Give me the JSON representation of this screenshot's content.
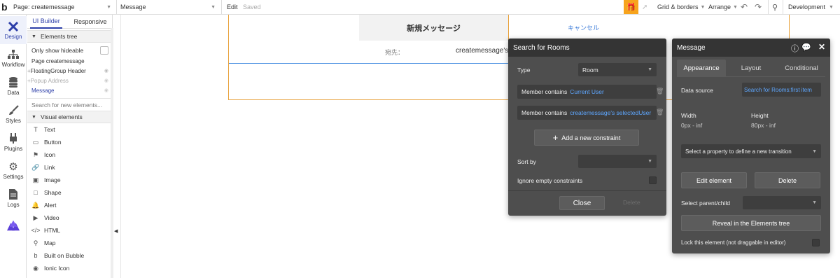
{
  "topbar": {
    "logo": "b",
    "page_label": "Page: createmessage",
    "element_select": "Message",
    "edit_label": "Edit",
    "saved_label": "Saved",
    "grid_borders_label": "Grid & borders",
    "arrange_label": "Arrange",
    "environment_label": "Development",
    "accent_color": "#f7a41d"
  },
  "rail": {
    "items": [
      {
        "label": "Design",
        "icon": "design-icon"
      },
      {
        "label": "Workflow",
        "icon": "workflow-icon"
      },
      {
        "label": "Data",
        "icon": "data-icon"
      },
      {
        "label": "Styles",
        "icon": "styles-icon"
      },
      {
        "label": "Plugins",
        "icon": "plugins-icon"
      },
      {
        "label": "Settings",
        "icon": "settings-icon"
      },
      {
        "label": "Logs",
        "icon": "logs-icon"
      }
    ]
  },
  "panel": {
    "tab_ui_builder": "UI Builder",
    "tab_responsive": "Responsive",
    "elements_tree_label": "Elements tree",
    "only_show_hideable": "Only show hideable",
    "tree": [
      {
        "label": "Page createmessage"
      },
      {
        "label": "FloatingGroup Header"
      },
      {
        "label": "Popup Address"
      },
      {
        "label": "Message"
      }
    ],
    "search_placeholder": "Search for new elements...",
    "visual_elements_label": "Visual elements",
    "visual_elements": [
      {
        "label": "Text",
        "icon": "text-icon",
        "glyph": "T"
      },
      {
        "label": "Button",
        "icon": "button-icon",
        "glyph": "▭"
      },
      {
        "label": "Icon",
        "icon": "flag-icon",
        "glyph": "⚑"
      },
      {
        "label": "Link",
        "icon": "link-icon",
        "glyph": "🔗"
      },
      {
        "label": "Image",
        "icon": "image-icon",
        "glyph": "▣"
      },
      {
        "label": "Shape",
        "icon": "shape-icon",
        "glyph": "□"
      },
      {
        "label": "Alert",
        "icon": "bell-icon",
        "glyph": "🔔"
      },
      {
        "label": "Video",
        "icon": "video-icon",
        "glyph": "▶"
      },
      {
        "label": "HTML",
        "icon": "code-icon",
        "glyph": "</>"
      },
      {
        "label": "Map",
        "icon": "map-pin-icon",
        "glyph": "⚲"
      },
      {
        "label": "Built on Bubble",
        "icon": "bubble-icon",
        "glyph": "b"
      },
      {
        "label": "Ionic Icon",
        "icon": "ionic-icon",
        "glyph": "◉"
      }
    ]
  },
  "canvas": {
    "header_title": "新規メッセージ",
    "cancel_label": "キャンセル",
    "to_label": "宛先：",
    "to_value": "createmessage's"
  },
  "search_popup": {
    "title": "Search for Rooms",
    "type_label": "Type",
    "type_value": "Room",
    "constraint1_label": "Member contains",
    "constraint1_value": "Current User",
    "constraint2_label": "Member contains",
    "constraint2_value": "createmessage's selectedUser",
    "add_constraint_label": "Add a new constraint",
    "sort_by_label": "Sort by",
    "ignore_empty_label": "Ignore empty constraints",
    "close_label": "Close",
    "delete_label": "Delete"
  },
  "message_popup": {
    "title": "Message",
    "tabs": [
      "Appearance",
      "Layout",
      "Conditional"
    ],
    "data_source_label": "Data source",
    "data_source_value": "Search for Rooms:first item",
    "width_label": "Width",
    "width_value": "0px - inf",
    "height_label": "Height",
    "height_value": "80px - inf",
    "transition_label": "Select a property to define a new transition",
    "edit_element_label": "Edit element",
    "delete_label": "Delete",
    "select_parent_label": "Select parent/child",
    "reveal_label": "Reveal in the Elements tree",
    "lock_label": "Lock this element (not draggable in editor)"
  }
}
